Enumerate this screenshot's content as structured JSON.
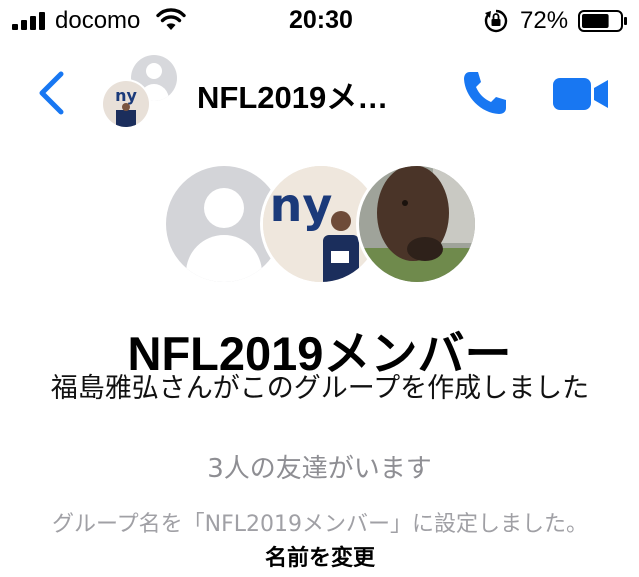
{
  "status_bar": {
    "carrier": "docomo",
    "time": "20:30",
    "battery_percent": "72%",
    "battery_level": 0.72,
    "icons": [
      "signal-icon",
      "wifi-icon",
      "rotation-lock-icon",
      "battery-icon"
    ]
  },
  "nav": {
    "title": "NFL2019メ…",
    "icons": [
      "back-icon",
      "phone-icon",
      "video-camera-icon"
    ]
  },
  "group": {
    "name": "NFL2019メンバー",
    "created_by": "福島雅弘さんがこのグループを作成しました",
    "member_count": "3人の友達がいます",
    "rename_notice": "グループ名を「NFL2019メンバー」に設定しました。",
    "rename_link": "名前を変更"
  },
  "colors": {
    "accent": "#1877f2",
    "secondary_text": "#8e8e93"
  }
}
